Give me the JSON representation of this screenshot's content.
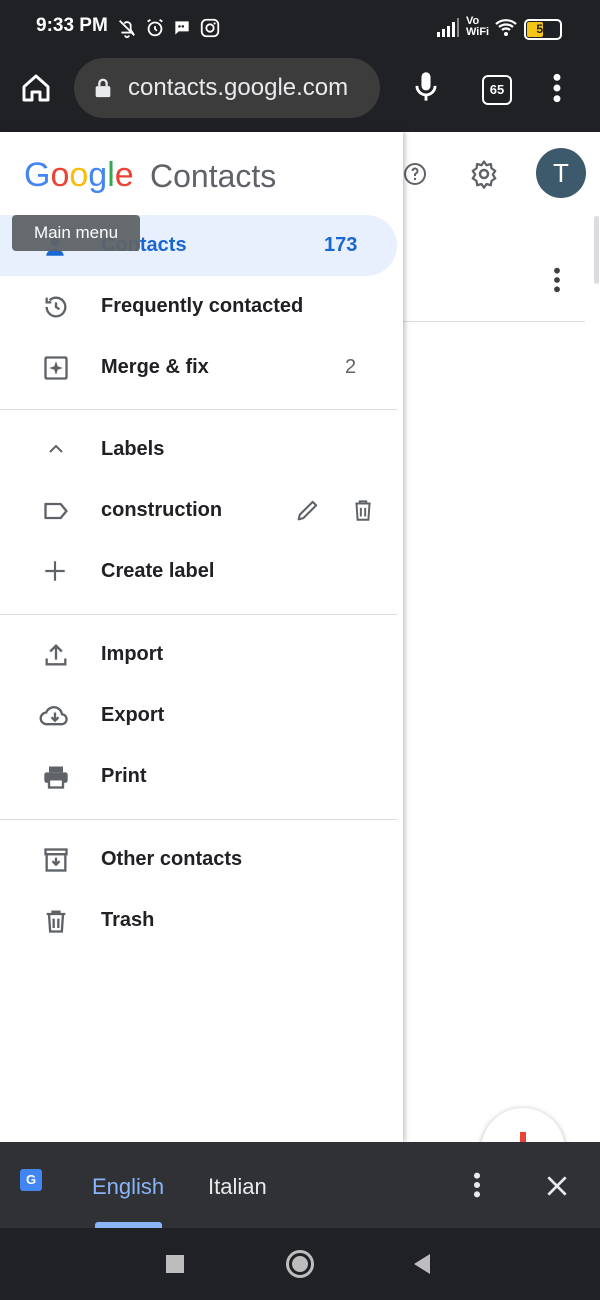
{
  "status_bar": {
    "time": "9:33 PM",
    "network_label": "Vo WiFi",
    "battery": "51",
    "icons": [
      "bell-off-icon",
      "alarm-icon",
      "chat-icon",
      "instagram-icon",
      "signal-icon",
      "wifi-icon",
      "battery-icon"
    ]
  },
  "browser": {
    "url": "contacts.google.com",
    "tab_count": "65",
    "icons": [
      "home-icon",
      "lock-icon",
      "mic-icon",
      "tabs-icon",
      "more-vert-icon"
    ]
  },
  "header": {
    "logo": "Google",
    "app_name": "Contacts",
    "avatar_letter": "T",
    "colors": {
      "blue": "#4285F4",
      "red": "#EA4335",
      "yellow": "#FBBC05",
      "green": "#34A853",
      "avatar_bg": "#3c5a6b"
    }
  },
  "tooltip": "Main menu",
  "drawer": {
    "primary": [
      {
        "label": "Contacts",
        "count": "173",
        "icon": "person-icon",
        "active": true
      },
      {
        "label": "Frequently contacted",
        "count": "",
        "icon": "history-icon"
      },
      {
        "label": "Merge & fix",
        "count": "2",
        "icon": "merge-fix-icon"
      }
    ],
    "labels_header": "Labels",
    "labels": [
      {
        "label": "construction",
        "icon": "label-icon"
      }
    ],
    "create_label": "Create label",
    "actions": [
      {
        "label": "Import",
        "icon": "upload-icon"
      },
      {
        "label": "Export",
        "icon": "cloud-download-icon"
      },
      {
        "label": "Print",
        "icon": "print-icon"
      }
    ],
    "secondary": [
      {
        "label": "Other contacts",
        "icon": "archive-icon"
      },
      {
        "label": "Trash",
        "icon": "trash-icon"
      }
    ],
    "active_color": "#e8f0fe",
    "active_text_color": "#1967d2"
  },
  "translate_bar": {
    "languages": [
      "English",
      "Italian"
    ],
    "selected": "English",
    "logo_letter": "G"
  },
  "nav_bar": {
    "icons": [
      "recents-icon",
      "home-circle-icon",
      "back-icon"
    ]
  }
}
